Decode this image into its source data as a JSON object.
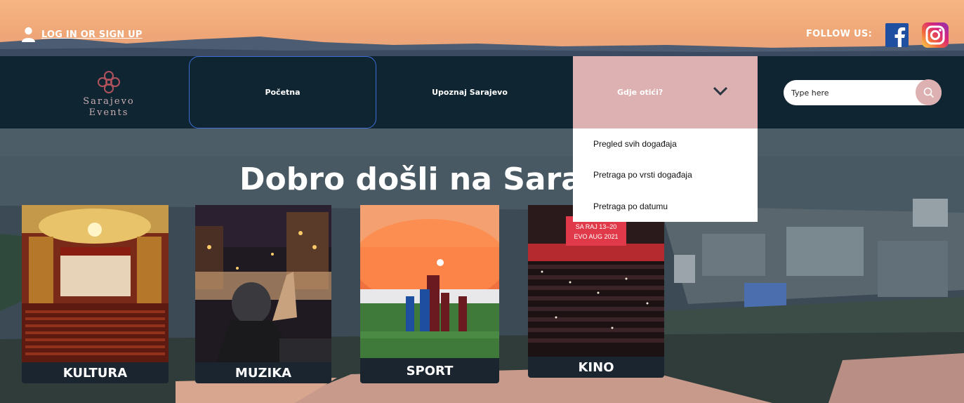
{
  "auth": {
    "login_label": "LOG IN OR SIGN UP"
  },
  "social": {
    "follow_label": "FOLLOW US:",
    "facebook_icon": "facebook-icon",
    "instagram_icon": "instagram-icon"
  },
  "brand": {
    "line1": "Sarajevo",
    "line2": "Events"
  },
  "nav": {
    "items": [
      {
        "label": "Početna"
      },
      {
        "label": "Upoznaj Sarajevo"
      },
      {
        "label": "Gdje otići?"
      }
    ]
  },
  "search": {
    "placeholder": "Type here"
  },
  "dropdown": {
    "items": [
      {
        "label": "Pregled svih događaja"
      },
      {
        "label": "Pretraga po vrsti događaja"
      },
      {
        "label": "Pretraga po datumu"
      }
    ]
  },
  "hero": {
    "title": "Dobro došli na Saraje"
  },
  "categories": [
    {
      "label": "KULTURA"
    },
    {
      "label": "MUZIKA"
    },
    {
      "label": "SPORT"
    },
    {
      "label": "KINO",
      "screen_text": "SA RAJ 13–20 EVO AUG 2021"
    }
  ],
  "colors": {
    "accent_pink": "#ddb0b1",
    "nav_bg": "#0f2532",
    "top_orange": "#f0a878",
    "active_border": "#3e6fd8"
  }
}
